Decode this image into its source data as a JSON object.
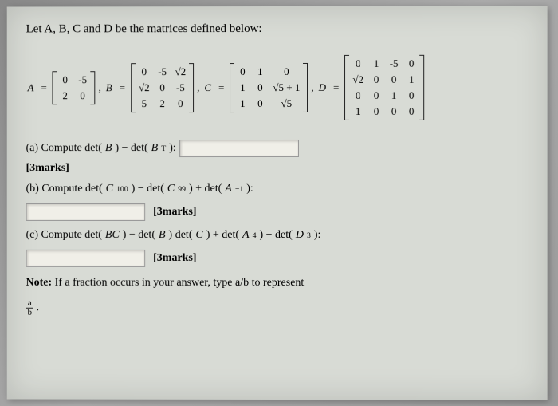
{
  "intro": "Let A, B, C and D be the matrices defined below:",
  "labels": {
    "A": "A",
    "B": "B",
    "C": "C",
    "D": "D",
    "eq": "="
  },
  "matrices": {
    "A": [
      [
        "0",
        "-5"
      ],
      [
        "2",
        "0"
      ]
    ],
    "B": [
      [
        "0",
        "-5",
        "√2"
      ],
      [
        "√2",
        "0",
        "-5"
      ],
      [
        "5",
        "2",
        "0"
      ]
    ],
    "C": [
      [
        "0",
        "1",
        "0"
      ],
      [
        "1",
        "0",
        "√5 + 1"
      ],
      [
        "1",
        "0",
        "√5"
      ]
    ],
    "D": [
      [
        "0",
        "1",
        "-5",
        "0"
      ],
      [
        "√2",
        "0",
        "0",
        "1"
      ],
      [
        "0",
        "0",
        "1",
        "0"
      ],
      [
        "1",
        "0",
        "0",
        "0"
      ]
    ]
  },
  "parts": {
    "a": {
      "prefix": "(a) Compute det(",
      "var1": "B",
      "mid1": ") − det(",
      "var2": "B",
      "sup": "T",
      "suffix": "):"
    },
    "b": {
      "prefix": "(b) Compute det(",
      "v1": "C",
      "s1": "100",
      "m1": ") − det(",
      "v2": "C",
      "s2": "99",
      "m2": ") + det(",
      "v3": "A",
      "s3": "−1",
      "suffix": "):"
    },
    "c": {
      "text1": "(c) Compute det(",
      "bc": "BC",
      "text2": ") − det(",
      "b": "B",
      "text3": ") det(",
      "cc": "C",
      "text4": ") + det(",
      "a": "A",
      "s4": "4",
      "text5": ") − det(",
      "d": "D",
      "s5": "3",
      "text6": "):"
    }
  },
  "marks": "[3marks]",
  "note": {
    "bold": "Note:",
    "rest": " If a fraction occurs in your answer, type a/b to represent"
  },
  "frac": {
    "top": "a",
    "bot": "b",
    "dot": "."
  }
}
